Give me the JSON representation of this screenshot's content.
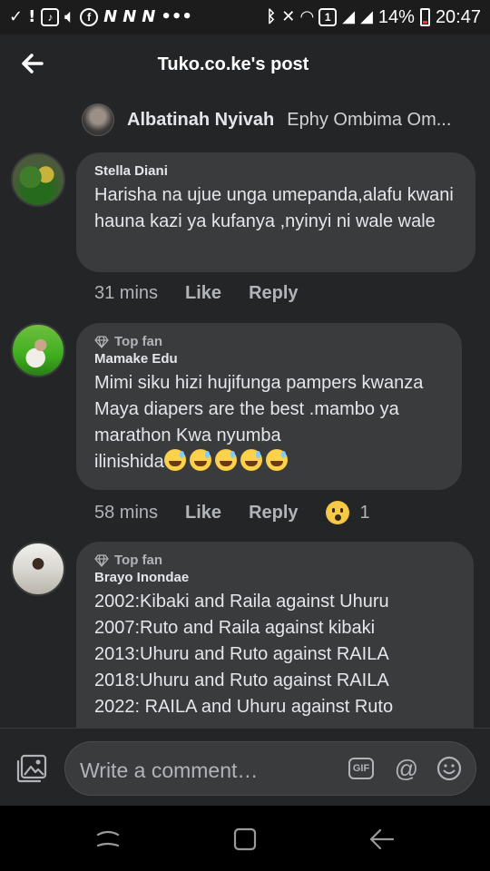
{
  "status_bar": {
    "battery": "14%",
    "time": "20:47"
  },
  "header": {
    "title": "Tuko.co.ke's post"
  },
  "reply_preview": {
    "name": "Albatinah Nyivah",
    "text": "Ephy Ombima Om..."
  },
  "comments": [
    {
      "author": "Stella Diani",
      "top_fan": "",
      "text": "Harisha na ujue unga umepanda,alafu kwani hauna kazi ya kufanya ,nyinyi ni wale wale",
      "time": "31 mins",
      "like": "Like",
      "reply": "Reply"
    },
    {
      "author": "Mamake Edu",
      "top_fan": "Top fan",
      "text": "Mimi siku hizi hujifunga pampers kwanza Maya diapers are the best .mambo ya marathon Kwa nyumba\nilinishida",
      "time": "58 mins",
      "like": "Like",
      "reply": "Reply",
      "reaction_count": "1"
    },
    {
      "author": "Brayo Inondae",
      "top_fan": "Top fan",
      "text": "2002:Kibaki and Raila against Uhuru\n2007:Ruto and Raila against kibaki\n2013:Uhuru and Ruto against RAILA\n2018:Uhuru and Ruto against RAILA\n2022: RAILA and Uhuru against Ruto"
    }
  ],
  "composer": {
    "placeholder": "Write a comment…",
    "gif_label": "GIF",
    "at_label": "@"
  },
  "icons": {
    "back": "arrow-left-icon",
    "photo": "photo-icon",
    "emoji": "smiley-icon",
    "top_fan": "diamond-icon"
  }
}
